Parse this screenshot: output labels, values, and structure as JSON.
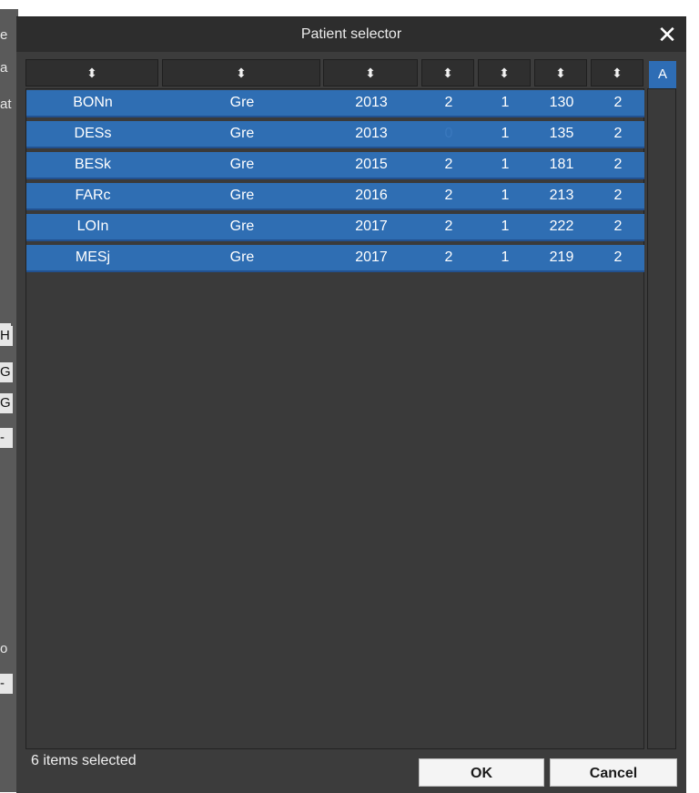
{
  "background": {
    "fragments": [
      "e",
      "a",
      "at",
      "H",
      "G",
      "G",
      "-",
      "o",
      "-"
    ]
  },
  "dialog": {
    "title": "Patient selector",
    "close_glyph": "✕",
    "a_button": "A",
    "status": "6 items selected",
    "ok_label": "OK",
    "cancel_label": "Cancel"
  },
  "columns": [
    "⬍",
    "⬍",
    "⬍",
    "⬍",
    "⬍",
    "⬍",
    "⬍"
  ],
  "rows": [
    [
      "BONn",
      "Gre",
      "2013",
      "2",
      "1",
      "130",
      "2"
    ],
    [
      "DESs",
      "Gre",
      "2013",
      "0",
      "1",
      "135",
      "2"
    ],
    [
      "BESk",
      "Gre",
      "2015",
      "2",
      "1",
      "181",
      "2"
    ],
    [
      "FARc",
      "Gre",
      "2016",
      "2",
      "1",
      "213",
      "2"
    ],
    [
      "LOIn",
      "Gre",
      "2017",
      "2",
      "1",
      "222",
      "2"
    ],
    [
      "MESj",
      "Gre",
      "2017",
      "2",
      "1",
      "219",
      "2"
    ]
  ],
  "colors": {
    "selection": "#2f6eb3",
    "dialog_bg": "#3c3c3c",
    "titlebar": "#2d2d2d"
  }
}
